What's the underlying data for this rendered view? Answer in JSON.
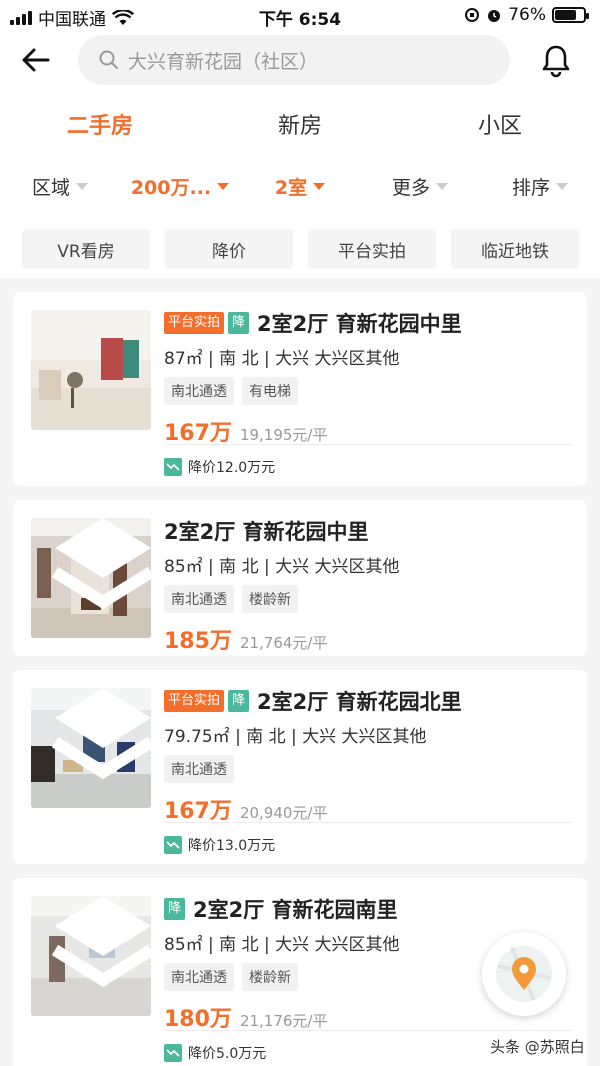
{
  "status_bar": {
    "carrier": "中国联通",
    "time": "下午 6:54",
    "battery": "76%",
    "battery_level": 0.76
  },
  "search": {
    "placeholder": "大兴育新花园（社区）"
  },
  "tabs": [
    {
      "label": "二手房",
      "active": true
    },
    {
      "label": "新房",
      "active": false
    },
    {
      "label": "小区",
      "active": false
    }
  ],
  "filters": [
    {
      "label": "区域",
      "active": false
    },
    {
      "label": "200万...",
      "active": true
    },
    {
      "label": "2室",
      "active": true
    },
    {
      "label": "更多",
      "active": false
    },
    {
      "label": "排序",
      "active": false
    }
  ],
  "quick_tags": [
    "VR看房",
    "降价",
    "平台实拍",
    "临近地铁"
  ],
  "badges": {
    "platform": "平台实拍",
    "drop": "降"
  },
  "listings": [
    {
      "title": "2室2厅  育新花园中里",
      "meta": "87㎡ | 南 北 | 大兴  大兴区其他",
      "tags": [
        "南北通透",
        "有电梯"
      ],
      "price": "167万",
      "unit_price": "19,195元/平",
      "price_drop": "降价12.0万元"
    },
    {
      "title": "2室2厅  育新花园中里",
      "meta": "85㎡ | 南 北 | 大兴  大兴区其他",
      "tags": [
        "南北通透",
        "楼龄新"
      ],
      "price": "185万",
      "unit_price": "21,764元/平"
    },
    {
      "title": "2室2厅  育新花园北里",
      "meta": "79.75㎡ | 南 北 | 大兴  大兴区其他",
      "tags": [
        "南北通透"
      ],
      "price": "167万",
      "unit_price": "20,940元/平",
      "price_drop": "降价13.0万元"
    },
    {
      "title": "2室2厅  育新花园南里",
      "meta": "85㎡ | 南 北 | 大兴  大兴区其他",
      "tags": [
        "南北通透",
        "楼龄新"
      ],
      "price": "180万",
      "unit_price": "21,176元/平",
      "price_drop": "降价5.0万元"
    }
  ],
  "watermark": "头条 @苏照白",
  "colors": {
    "accent": "#f36d2b",
    "drop_green": "#4bb89b"
  }
}
